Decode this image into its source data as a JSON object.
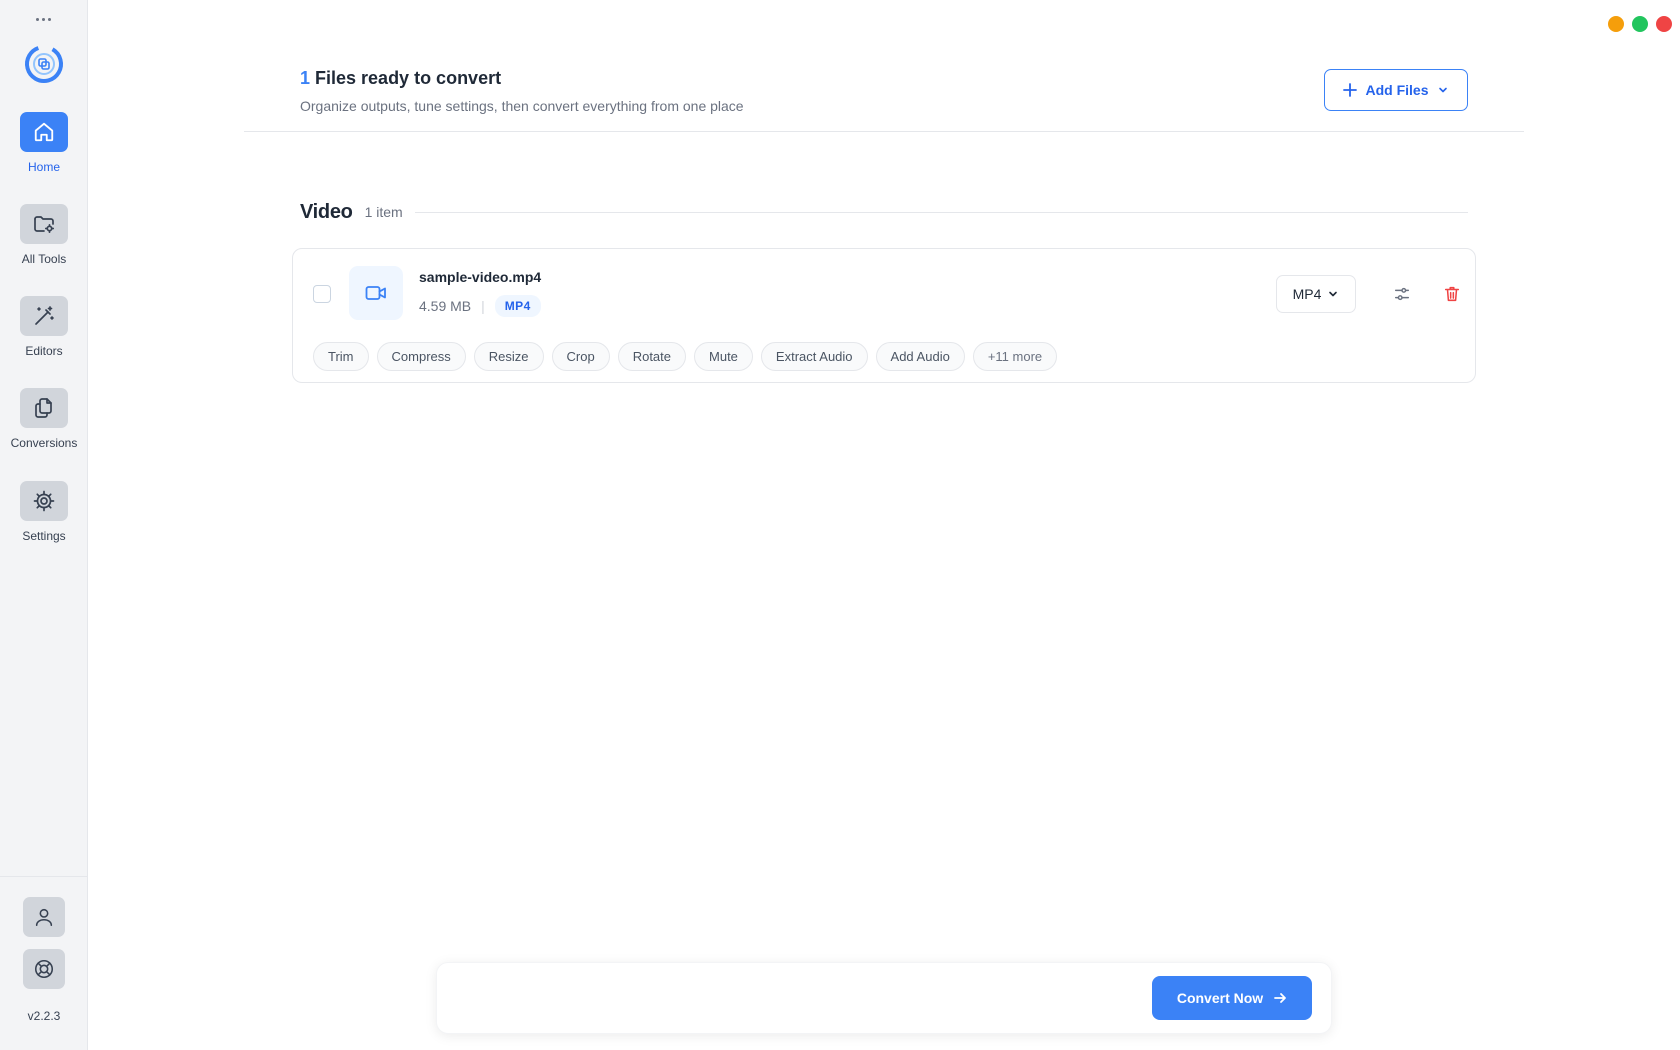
{
  "sidebar": {
    "items": [
      {
        "label": "Home",
        "icon": "home-icon",
        "active": true
      },
      {
        "label": "All Tools",
        "icon": "folder-gear-icon",
        "active": false
      },
      {
        "label": "Editors",
        "icon": "magic-wand-icon",
        "active": false
      },
      {
        "label": "Conversions",
        "icon": "copy-files-icon",
        "active": false
      },
      {
        "label": "Settings",
        "icon": "gear-icon",
        "active": false
      }
    ],
    "bottom": [
      {
        "icon": "user-icon"
      },
      {
        "icon": "lifebuoy-icon"
      }
    ],
    "version": "v2.2.3"
  },
  "window_controls": [
    {
      "name": "minimize",
      "color": "#f59e0b"
    },
    {
      "name": "maximize",
      "color": "#22c55e"
    },
    {
      "name": "close",
      "color": "#ef4444"
    }
  ],
  "header": {
    "count": "1",
    "title_rest": " Files ready to convert",
    "subtitle": "Organize outputs, tune settings, then convert everything from one place",
    "add_files_label": "Add Files"
  },
  "section": {
    "title": "Video",
    "count_label": "1 item"
  },
  "file": {
    "name": "sample-video.mp4",
    "size": "4.59 MB",
    "separator": "|",
    "type_badge": "MP4",
    "output_format": "MP4",
    "actions": [
      "Trim",
      "Compress",
      "Resize",
      "Crop",
      "Rotate",
      "Mute",
      "Extract Audio",
      "Add Audio"
    ],
    "more_label": "+11 more"
  },
  "footer": {
    "convert_label": "Convert Now"
  },
  "colors": {
    "accent": "#3b82f6",
    "danger": "#ef4444",
    "sidebar_bg": "#f3f4f6"
  }
}
